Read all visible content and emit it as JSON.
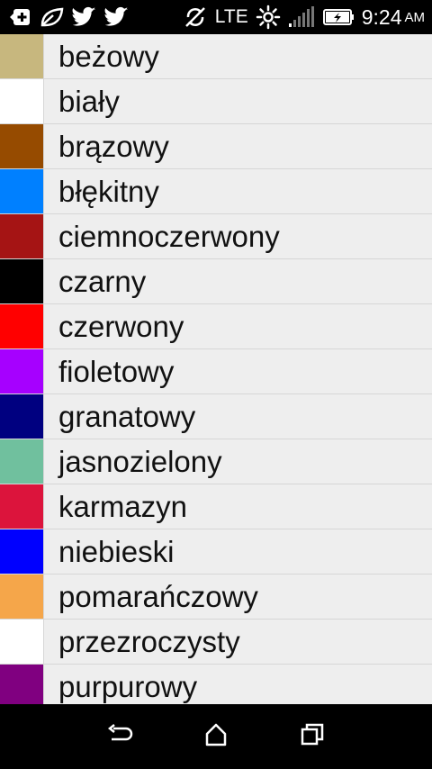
{
  "status_bar": {
    "network": "LTE",
    "time": "9:24",
    "ampm": "AM",
    "icons": [
      "add-box-icon",
      "leaf-icon",
      "twitter-icon",
      "twitter-icon",
      "sync-off-icon",
      "brightness-icon",
      "signal-icon",
      "battery-charging-icon"
    ]
  },
  "colors": [
    {
      "name": "beżowy",
      "color": "#c7b77e"
    },
    {
      "name": "biały",
      "color": "#ffffff"
    },
    {
      "name": "brązowy",
      "color": "#964b00"
    },
    {
      "name": "błękitny",
      "color": "#0080ff"
    },
    {
      "name": "ciemnoczerwony",
      "color": "#a51414"
    },
    {
      "name": "czarny",
      "color": "#000000"
    },
    {
      "name": "czerwony",
      "color": "#ff0000"
    },
    {
      "name": "fioletowy",
      "color": "#a600ff"
    },
    {
      "name": "granatowy",
      "color": "#000080"
    },
    {
      "name": "jasnozielony",
      "color": "#70c09e"
    },
    {
      "name": "karmazyn",
      "color": "#dc143c"
    },
    {
      "name": "niebieski",
      "color": "#0000ff"
    },
    {
      "name": "pomarańczowy",
      "color": "#f5a64a"
    },
    {
      "name": "przezroczysty",
      "color": "#ffffff"
    },
    {
      "name": "purpurowy",
      "color": "#800080"
    }
  ],
  "nav_bar": {
    "buttons": [
      "back-icon",
      "home-icon",
      "recents-icon"
    ]
  }
}
